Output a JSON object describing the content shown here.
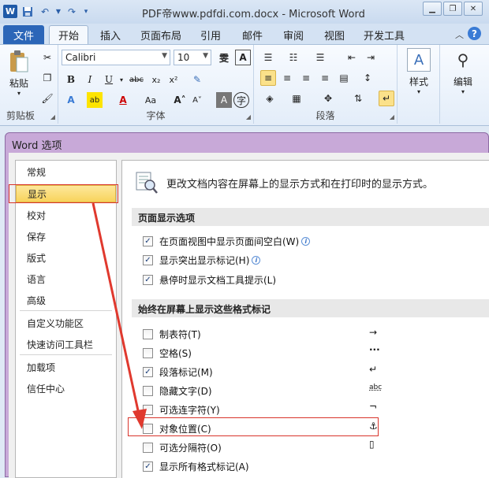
{
  "window": {
    "title": "PDF帝www.pdfdi.com.docx - Microsoft Word"
  },
  "quick_access": [
    "word-logo",
    "save-icon",
    "undo-icon",
    "redo-icon",
    "customize-icon"
  ],
  "tabs": [
    {
      "label": "文件"
    },
    {
      "label": "开始"
    },
    {
      "label": "插入"
    },
    {
      "label": "页面布局"
    },
    {
      "label": "引用"
    },
    {
      "label": "邮件"
    },
    {
      "label": "审阅"
    },
    {
      "label": "视图"
    },
    {
      "label": "开发工具"
    }
  ],
  "ribbon": {
    "clipboard": {
      "paste_label": "粘贴",
      "group_label": "剪贴板"
    },
    "font": {
      "name": "Calibri",
      "size": "10",
      "group_label": "字体"
    },
    "paragraph": {
      "group_label": "段落"
    },
    "styles": {
      "label": "样式"
    },
    "editing": {
      "label": "编辑"
    }
  },
  "dialog": {
    "title": "Word 选项",
    "nav": [
      "常规",
      "显示",
      "校对",
      "保存",
      "版式",
      "语言",
      "高级",
      "自定义功能区",
      "快速访问工具栏",
      "加载项",
      "信任中心"
    ],
    "selected_nav": "显示",
    "header_text": "更改文档内容在屏幕上的显示方式和在打印时的显示方式。",
    "section1": {
      "title": "页面显示选项",
      "options": [
        {
          "label": "在页面视图中显示页面间空白(W)",
          "checked": true,
          "info": true
        },
        {
          "label": "显示突出显示标记(H)",
          "checked": true,
          "info": true
        },
        {
          "label": "悬停时显示文档工具提示(L)",
          "checked": true,
          "info": false
        }
      ]
    },
    "section2": {
      "title": "始终在屏幕上显示这些格式标记",
      "options": [
        {
          "label": "制表符(T)",
          "checked": false,
          "mark": "→"
        },
        {
          "label": "空格(S)",
          "checked": false,
          "mark": "···"
        },
        {
          "label": "段落标记(M)",
          "checked": true,
          "mark": "↵"
        },
        {
          "label": "隐藏文字(D)",
          "checked": false,
          "mark": "abc"
        },
        {
          "label": "可选连字符(Y)",
          "checked": false,
          "mark": "¬"
        },
        {
          "label": "对象位置(C)",
          "checked": false,
          "mark": "⚓"
        },
        {
          "label": "可选分隔符(O)",
          "checked": false,
          "mark": "▯"
        },
        {
          "label": "显示所有格式标记(A)",
          "checked": true,
          "mark": ""
        }
      ]
    }
  },
  "colors": {
    "highlight": "#d9342b",
    "accent_blue": "#2c66b8",
    "nav_selected": "#f8d45c"
  }
}
